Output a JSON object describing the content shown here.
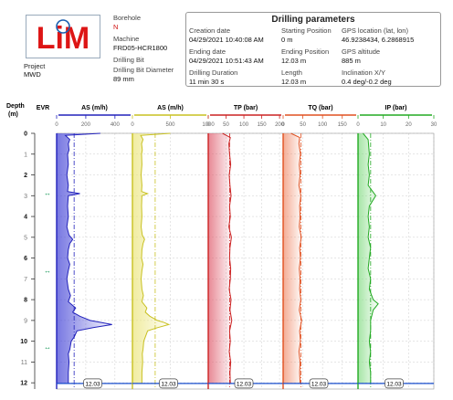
{
  "logo_text": "LiM",
  "header": {
    "project_label": "Project",
    "project_value": "MWD",
    "borehole_label": "Borehole",
    "borehole_value": "N",
    "machine_label": "Machine",
    "machine_value": "FRD05-HCR1800",
    "bit_label": "Drilling Bit",
    "bit_value": "",
    "bit_diam_label": "Drilling Bit Diameter",
    "bit_diam_value": "89 mm"
  },
  "params": {
    "title": "Drilling parameters",
    "creation_label": "Creation date",
    "creation_value": "04/29/2021 10:40:08 AM",
    "ending_label": "Ending date",
    "ending_value": "04/29/2021 10:51:43 AM",
    "duration_label": "Drilling Duration",
    "duration_value": "11 min 30 s",
    "start_label": "Starting Position",
    "start_value": "0 m",
    "endpos_label": "Ending Position",
    "endpos_value": "12.03 m",
    "length_label": "Length",
    "length_value": "12.03 m",
    "gps_label": "GPS location (lat, lon)",
    "gps_value": "46.9238434, 6.2868915",
    "alt_label": "GPS altitude",
    "alt_value": "885 m",
    "incl_label": "Inclination X/Y",
    "incl_value": "0.4 deg/-0.2 deg"
  },
  "chart_data": {
    "type": "line",
    "orientation": "vertical-depth",
    "depth_label": "Depth",
    "depth_unit": "(m)",
    "evr_label": "EVR",
    "depth_range": [
      0,
      12.03
    ],
    "depth_ticks": [
      0,
      1,
      2,
      3,
      4,
      5,
      6,
      7,
      8,
      9,
      10,
      11,
      12
    ],
    "end_marker": "12.03",
    "evr_markers": [
      2.85,
      6.6,
      10.25
    ],
    "tracks": [
      {
        "name": "AS (m/h)",
        "color": "#2222bb",
        "fill": "#4a4ad8",
        "xlim": [
          0,
          520
        ],
        "ticks": [
          0,
          200,
          400
        ],
        "tick_labels": [
          "0",
          "200",
          "400"
        ],
        "ref_line": 120,
        "depth": [
          0,
          0.1,
          0.3,
          0.5,
          0.8,
          1,
          1.5,
          2,
          2.5,
          2.8,
          2.9,
          3,
          3.5,
          4,
          4.5,
          4.9,
          5.1,
          5.3,
          5.6,
          6,
          6.3,
          6.6,
          7,
          7.5,
          7.8,
          8.1,
          8.4,
          8.6,
          8.8,
          9,
          9.1,
          9.2,
          9.35,
          9.5,
          9.8,
          10,
          10.2,
          10.4,
          10.6,
          11,
          11.5,
          12.03
        ],
        "values": [
          300,
          60,
          90,
          80,
          85,
          75,
          80,
          70,
          80,
          75,
          160,
          80,
          75,
          80,
          70,
          85,
          110,
          90,
          80,
          75,
          90,
          80,
          70,
          80,
          95,
          80,
          130,
          110,
          160,
          230,
          310,
          380,
          250,
          140,
          120,
          100,
          95,
          90,
          80,
          85,
          80,
          80
        ]
      },
      {
        "name": "AS (m/h)",
        "color": "#c8c020",
        "fill": "#ece680",
        "xlim": [
          0,
          1000
        ],
        "ticks": [
          0,
          500,
          1000
        ],
        "tick_labels": [
          "0",
          "500",
          "1000"
        ],
        "ref_line": 300,
        "depth": [
          0,
          0.1,
          0.3,
          0.5,
          0.8,
          1,
          1.5,
          2,
          2.5,
          2.8,
          2.9,
          3,
          3.5,
          4,
          4.5,
          4.9,
          5.1,
          5.3,
          5.6,
          6,
          6.3,
          6.6,
          7,
          7.5,
          7.8,
          8.1,
          8.4,
          8.6,
          8.8,
          9,
          9.1,
          9.2,
          9.35,
          9.5,
          9.8,
          10,
          10.2,
          10.4,
          10.6,
          11,
          11.5,
          12.03
        ],
        "values": [
          500,
          110,
          140,
          120,
          130,
          120,
          125,
          115,
          125,
          120,
          200,
          125,
          120,
          125,
          115,
          130,
          160,
          140,
          125,
          120,
          140,
          125,
          115,
          125,
          145,
          125,
          190,
          170,
          230,
          330,
          420,
          480,
          330,
          200,
          170,
          150,
          145,
          140,
          130,
          135,
          125,
          125
        ]
      },
      {
        "name": "TP (bar)",
        "color": "#cc2222",
        "fill": "#e06070",
        "xlim": [
          0,
          210
        ],
        "ticks": [
          0,
          50,
          100,
          150,
          200
        ],
        "tick_labels": [
          "0",
          "50",
          "100",
          "150",
          "200"
        ],
        "ref_line": 60,
        "depth": [
          0,
          0.2,
          0.5,
          1,
          1.5,
          2,
          2.5,
          3,
          3.5,
          4,
          4.5,
          5,
          5.5,
          6,
          6.5,
          7,
          7.5,
          8,
          8.5,
          9,
          9.5,
          10,
          10.5,
          11,
          11.5,
          12.03
        ],
        "values": [
          40,
          62,
          58,
          60,
          63,
          59,
          61,
          64,
          60,
          62,
          58,
          65,
          61,
          60,
          63,
          62,
          59,
          64,
          61,
          66,
          60,
          62,
          59,
          63,
          61,
          62
        ]
      },
      {
        "name": "TQ (bar)",
        "color": "#e05020",
        "fill": "#f09070",
        "xlim": [
          0,
          190
        ],
        "ticks": [
          0,
          50,
          100,
          150
        ],
        "tick_labels": [
          "0",
          "50",
          "100",
          "150"
        ],
        "ref_line": 45,
        "depth": [
          0,
          0.2,
          0.5,
          1,
          1.5,
          2,
          2.5,
          3,
          3.5,
          4,
          4.5,
          5,
          5.5,
          6,
          6.5,
          7,
          7.5,
          8,
          8.5,
          9,
          9.5,
          10,
          10.5,
          11,
          11.5,
          12.03
        ],
        "values": [
          20,
          42,
          40,
          44,
          41,
          43,
          40,
          45,
          42,
          43,
          41,
          46,
          42,
          44,
          41,
          43,
          42,
          45,
          41,
          47,
          42,
          44,
          40,
          43,
          42,
          43
        ]
      },
      {
        "name": "IP (bar)",
        "color": "#22aa22",
        "fill": "#88dd88",
        "xlim": [
          0,
          30
        ],
        "ticks": [
          0,
          10,
          20,
          30
        ],
        "tick_labels": [
          "0",
          "10",
          "20",
          "30"
        ],
        "ref_line": 5,
        "depth": [
          0,
          0.3,
          1,
          1.5,
          2,
          2.5,
          3,
          3.5,
          4,
          4.5,
          5,
          5.5,
          6,
          6.5,
          7,
          7.5,
          8,
          8.2,
          8.5,
          9,
          9.5,
          10,
          10.5,
          11,
          11.5,
          12.03
        ],
        "values": [
          2,
          4,
          4.5,
          4,
          4.5,
          4,
          7,
          4.5,
          4,
          4.5,
          4,
          5,
          4.5,
          4,
          5,
          4.5,
          6,
          8,
          6,
          5,
          5,
          4.5,
          5,
          4.5,
          5,
          5
        ]
      }
    ]
  }
}
